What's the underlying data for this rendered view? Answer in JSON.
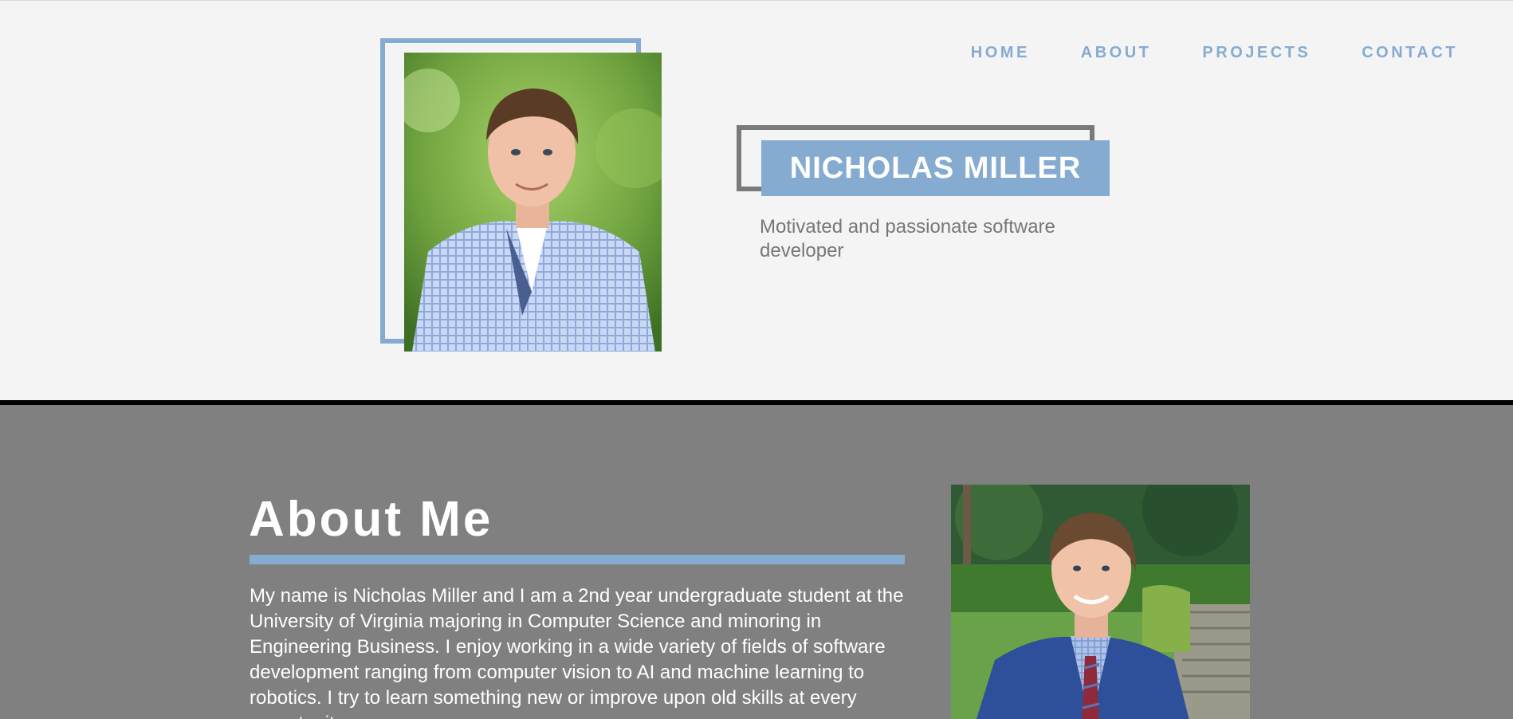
{
  "nav": {
    "items": [
      {
        "label": "HOME"
      },
      {
        "label": "ABOUT"
      },
      {
        "label": "PROJECTS"
      },
      {
        "label": "CONTACT"
      }
    ]
  },
  "hero": {
    "name": "NICHOLAS MILLER",
    "tagline": "Motivated and passionate software developer"
  },
  "about": {
    "title": "About Me",
    "body": "My name is Nicholas Miller and I am a 2nd year undergraduate student at the University of Virginia majoring in Computer Science and minoring in Engineering Business. I enjoy working in a wide variety of fields of software development ranging from computer vision to AI and machine learning to robotics. I try to learn something new or improve upon old skills at every opportunity."
  },
  "colors": {
    "accent": "#86abd1",
    "hero_bg": "#f4f4f4",
    "about_bg": "#808080",
    "frame_gray": "#7a7a7a"
  }
}
